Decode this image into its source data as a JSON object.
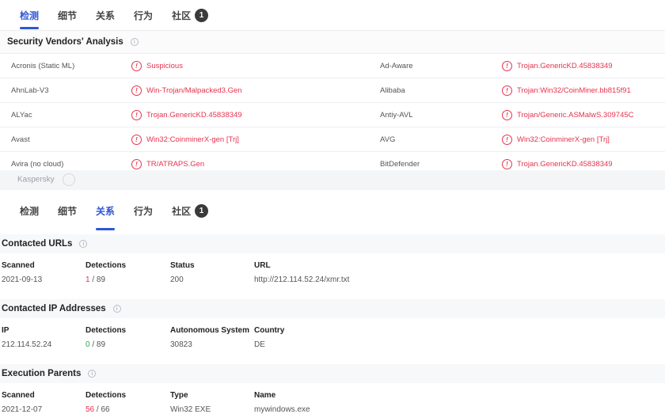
{
  "tabs": [
    {
      "label": "检测"
    },
    {
      "label": "细节"
    },
    {
      "label": "关系"
    },
    {
      "label": "行为"
    },
    {
      "label": "社区",
      "badge": "1"
    }
  ],
  "vendors_section": {
    "title": "Security Vendors' Analysis",
    "rows": [
      {
        "left_vendor": "Acronis (Static ML)",
        "left_verdict": "Suspicious",
        "right_vendor": "Ad-Aware",
        "right_verdict": "Trojan.GenericKD.45838349"
      },
      {
        "left_vendor": "AhnLab-V3",
        "left_verdict": "Win-Trojan/Malpacked3.Gen",
        "right_vendor": "Alibaba",
        "right_verdict": "Trojan:Win32/CoinMiner.bb815f91"
      },
      {
        "left_vendor": "ALYac",
        "left_verdict": "Trojan.GenericKD.45838349",
        "right_vendor": "Antiy-AVL",
        "right_verdict": "Trojan/Generic.ASMalwS.309745C"
      },
      {
        "left_vendor": "Avast",
        "left_verdict": "Win32:CoinminerX-gen [Trj]",
        "right_vendor": "AVG",
        "right_verdict": "Win32:CoinminerX-gen [Trj]"
      },
      {
        "left_vendor": "Avira (no cloud)",
        "left_verdict": "TR/ATRAPS.Gen",
        "right_vendor": "BitDefender",
        "right_verdict": "Trojan.GenericKD.45838349"
      }
    ]
  },
  "gap_text": "Kaspersky",
  "contacted_urls": {
    "title": "Contacted URLs",
    "headers": [
      "Scanned",
      "Detections",
      "Status",
      "URL"
    ],
    "rows": [
      {
        "scanned": "2021-09-13",
        "det_pos": "1",
        "det_total": " / 89",
        "status": "200",
        "url": "http://212.114.52.24/xmr.txt"
      }
    ]
  },
  "contacted_ips": {
    "title": "Contacted IP Addresses",
    "headers": [
      "IP",
      "Detections",
      "Autonomous System",
      "Country"
    ],
    "rows": [
      {
        "ip": "212.114.52.24",
        "det_pos": "0",
        "det_total": " / 89",
        "as": "30823",
        "country": "DE"
      }
    ]
  },
  "execution_parents": {
    "title": "Execution Parents",
    "headers": [
      "Scanned",
      "Detections",
      "Type",
      "Name"
    ],
    "rows": [
      {
        "scanned": "2021-12-07",
        "det_pos": "56",
        "det_total": " / 66",
        "type": "Win32 EXE",
        "name": "mywindows.exe"
      }
    ]
  },
  "icons": {
    "info": "info-circle-icon",
    "warning": "alert-circle-icon"
  },
  "colors": {
    "accent": "#2f56d8",
    "danger": "#e5334f",
    "ok": "#2aa84f"
  }
}
